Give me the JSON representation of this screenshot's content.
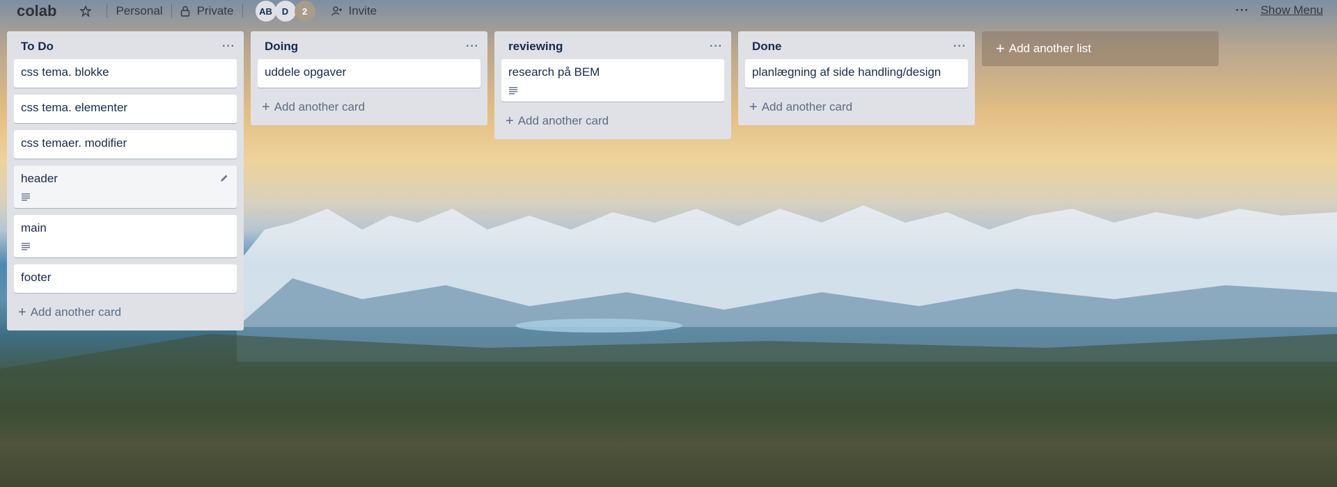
{
  "header": {
    "board_title": "colab",
    "personal_label": "Personal",
    "visibility_label": "Private",
    "invite_label": "Invite",
    "members": [
      {
        "initials": "AB"
      },
      {
        "initials": "D"
      },
      {
        "initials": "2"
      }
    ],
    "show_menu_label": "Show Menu",
    "menu_dots": "···"
  },
  "lists": [
    {
      "title": "To Do",
      "menu": "···",
      "cards": [
        {
          "text": "css tema. blokke"
        },
        {
          "text": "css tema. elementer"
        },
        {
          "text": "css temaer. modifier"
        },
        {
          "text": "header",
          "has_description": true,
          "hovered": true
        },
        {
          "text": "main",
          "has_description": true
        },
        {
          "text": "footer"
        }
      ],
      "add_card_label": "Add another card"
    },
    {
      "title": "Doing",
      "menu": "···",
      "cards": [
        {
          "text": "uddele opgaver"
        }
      ],
      "add_card_label": "Add another card"
    },
    {
      "title": "reviewing",
      "menu": "···",
      "cards": [
        {
          "text": "research på BEM",
          "has_description": true
        }
      ],
      "add_card_label": "Add another card"
    },
    {
      "title": "Done",
      "menu": "···",
      "cards": [
        {
          "text": "planlægning af side handling/design"
        }
      ],
      "add_card_label": "Add another card"
    }
  ],
  "add_list_label": "Add another list",
  "colors": {
    "list_bg": "#dfe1e6",
    "card_bg": "#ffffff",
    "text": "#172b4d",
    "muted": "#5e6c84"
  }
}
